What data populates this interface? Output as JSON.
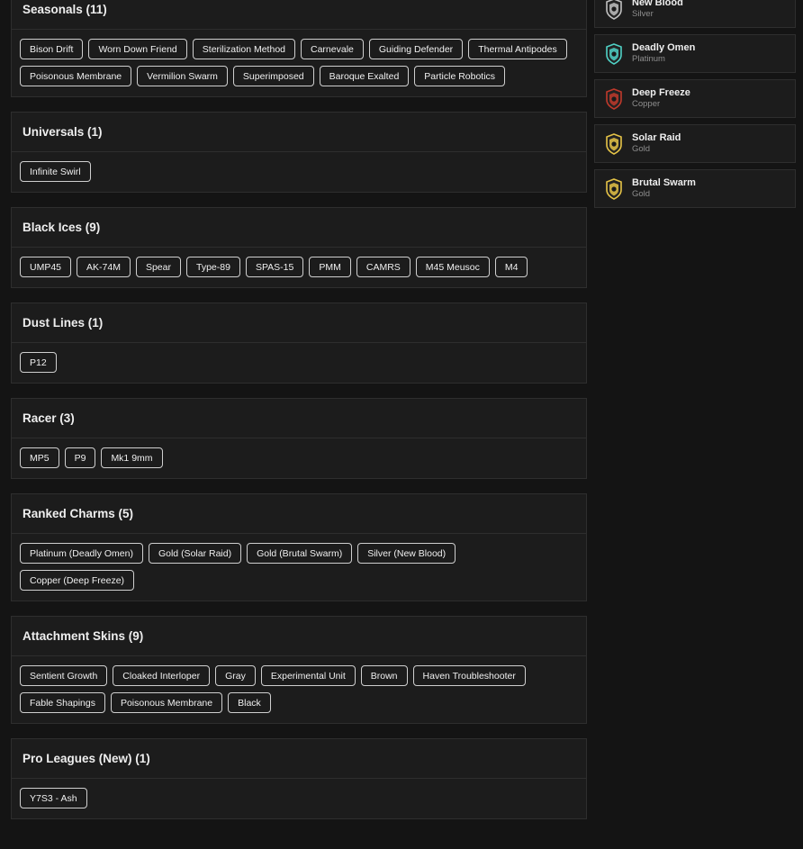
{
  "sections": [
    {
      "title": "Seasonals (11)",
      "items": [
        "Bison Drift",
        "Worn Down Friend",
        "Sterilization Method",
        "Carnevale",
        "Guiding Defender",
        "Thermal Antipodes",
        "Poisonous Membrane",
        "Vermilion Swarm",
        "Superimposed",
        "Baroque Exalted",
        "Particle Robotics"
      ]
    },
    {
      "title": "Universals (1)",
      "items": [
        "Infinite Swirl"
      ]
    },
    {
      "title": "Black Ices (9)",
      "items": [
        "UMP45",
        "AK-74M",
        "Spear",
        "Type-89",
        "SPAS-15",
        "PMM",
        "CAMRS",
        "M45 Meusoc",
        "M4"
      ]
    },
    {
      "title": "Dust Lines (1)",
      "items": [
        "P12"
      ]
    },
    {
      "title": "Racer (3)",
      "items": [
        "MP5",
        "P9",
        "Mk1 9mm"
      ]
    },
    {
      "title": "Ranked Charms (5)",
      "items": [
        "Platinum (Deadly Omen)",
        "Gold (Solar Raid)",
        "Gold (Brutal Swarm)",
        "Silver (New Blood)",
        "Copper (Deep Freeze)"
      ]
    },
    {
      "title": "Attachment Skins (9)",
      "items": [
        "Sentient Growth",
        "Cloaked Interloper",
        "Gray",
        "Experimental Unit",
        "Brown",
        "Haven Troubleshooter",
        "Fable Shapings",
        "Poisonous Membrane",
        "Black"
      ]
    },
    {
      "title": "Pro Leagues (New) (1)",
      "items": [
        "Y7S3 - Ash"
      ]
    }
  ],
  "charms": [
    {
      "name": "New Blood",
      "rank": "Silver",
      "color": "#c0c0c0"
    },
    {
      "name": "Deadly Omen",
      "rank": "Platinum",
      "color": "#4fd1c5"
    },
    {
      "name": "Deep Freeze",
      "rank": "Copper",
      "color": "#c0392b"
    },
    {
      "name": "Solar Raid",
      "rank": "Gold",
      "color": "#e5c347"
    },
    {
      "name": "Brutal Swarm",
      "rank": "Gold",
      "color": "#e5c347"
    }
  ]
}
